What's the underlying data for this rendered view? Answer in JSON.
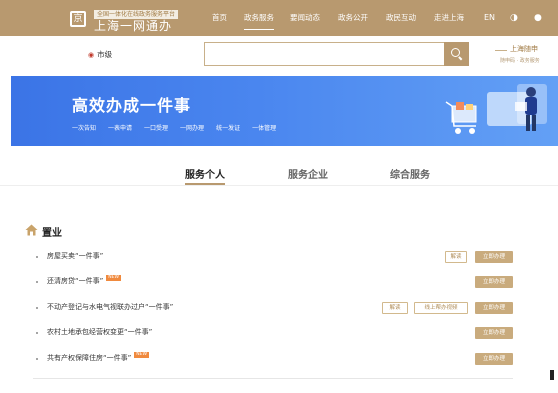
{
  "header": {
    "logo_glyph": "京",
    "logo_subtitle": "全国一体化在线政务服务平台",
    "logo_title": "上海一网通办",
    "nav": [
      "首页",
      "政务服务",
      "要闻动态",
      "政务公开",
      "政民互动",
      "走进上海"
    ],
    "active_nav": "政务服务",
    "lang": "EN"
  },
  "search": {
    "city": "市级",
    "placeholder": "",
    "side_title": "上海随申",
    "side_sub": "随申码 · 政务服务"
  },
  "banner": {
    "title": "高效办成一件事",
    "tags": [
      "一次告知",
      "一表申请",
      "一口受理",
      "一网办理",
      "统一发证",
      "一体管理"
    ]
  },
  "tabs": [
    "服务个人",
    "服务企业",
    "综合服务"
  ],
  "active_tab": "服务个人",
  "section": {
    "title": "置业",
    "items": [
      {
        "label": "房屋买卖“一件事”",
        "new_badge": "",
        "buttons": [
          "解读",
          "立即办理"
        ]
      },
      {
        "label": "还清房贷“一件事”",
        "new_badge": "NEW",
        "buttons": [
          "立即办理"
        ]
      },
      {
        "label": "不动产登记与水电气视联办过户“一件事”",
        "new_badge": "",
        "buttons": [
          "解读",
          "线上帮办视频",
          "立即办理"
        ]
      },
      {
        "label": "农村土地承包经营权变更“一件事”",
        "new_badge": "",
        "buttons": [
          "立即办理"
        ]
      },
      {
        "label": "共有产权保障住房“一件事”",
        "new_badge": "NEW",
        "buttons": [
          "立即办理"
        ]
      }
    ]
  },
  "colors": {
    "brand": "#b8996f",
    "banner": "#3b74e6",
    "new_badge": "#f08a3e"
  }
}
